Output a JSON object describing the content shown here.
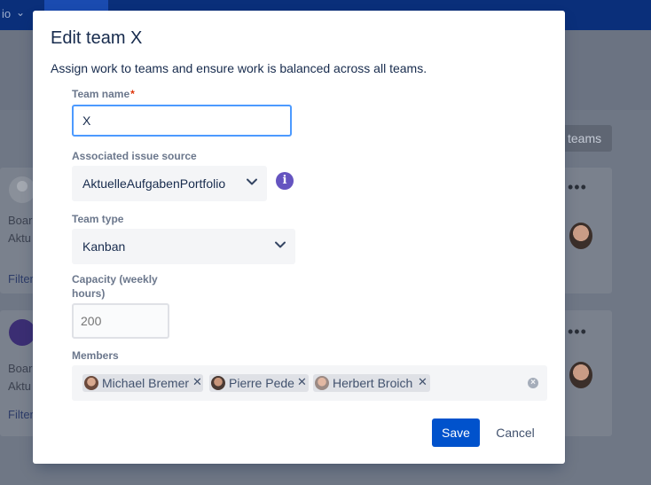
{
  "background": {
    "nav_text": "io",
    "teams_button": "teams",
    "card1": {
      "board_label": "Boar",
      "board_value": "Aktu",
      "filter_link": "Filter"
    },
    "card2": {
      "board_label": "Boar",
      "board_value": "Aktu",
      "filter_link": "Filter"
    }
  },
  "modal": {
    "title": "Edit team X",
    "description": "Assign work to teams and ensure work is balanced across all teams.",
    "team_name": {
      "label": "Team name",
      "required_marker": "*",
      "value": "X"
    },
    "issue_source": {
      "label": "Associated issue source",
      "value": "AktuelleAufgabenPortfolio",
      "info_icon": "info-icon"
    },
    "team_type": {
      "label": "Team type",
      "value": "Kanban"
    },
    "capacity": {
      "label_line1": "Capacity (weekly",
      "label_line2": "hours)",
      "placeholder": "200"
    },
    "members": {
      "label": "Members",
      "chips": [
        {
          "name": "Michael Bremer"
        },
        {
          "name": "Pierre Pede"
        },
        {
          "name": "Herbert Broich"
        }
      ]
    },
    "save_label": "Save",
    "cancel_label": "Cancel"
  },
  "colors": {
    "primary": "#0052cc",
    "focus_border": "#4c9aff",
    "info": "#6554c0",
    "required": "#de350b"
  }
}
